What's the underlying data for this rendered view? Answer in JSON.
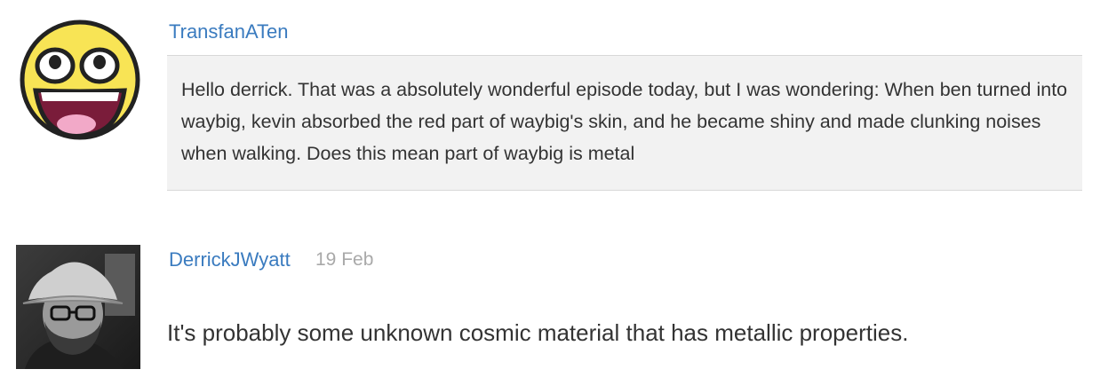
{
  "comments": [
    {
      "author": "TransfanATen",
      "avatar": "smiley-face-icon",
      "text": "Hello derrick. That was a absolutely wonderful episode today, but I was wondering: When ben turned into waybig, kevin absorbed the red part of waybig's skin, and he became shiny and made clunking noises when walking. Does this mean part of waybig is metal"
    },
    {
      "author": "DerrickJWyatt",
      "avatar": "user-photo",
      "date": "19 Feb",
      "text": "It's probably some unknown cosmic material that has metallic properties."
    }
  ],
  "colors": {
    "link": "#3a7bbf",
    "date": "#a9a9a9",
    "quote_bg": "#f2f2f2",
    "text": "#333333"
  }
}
